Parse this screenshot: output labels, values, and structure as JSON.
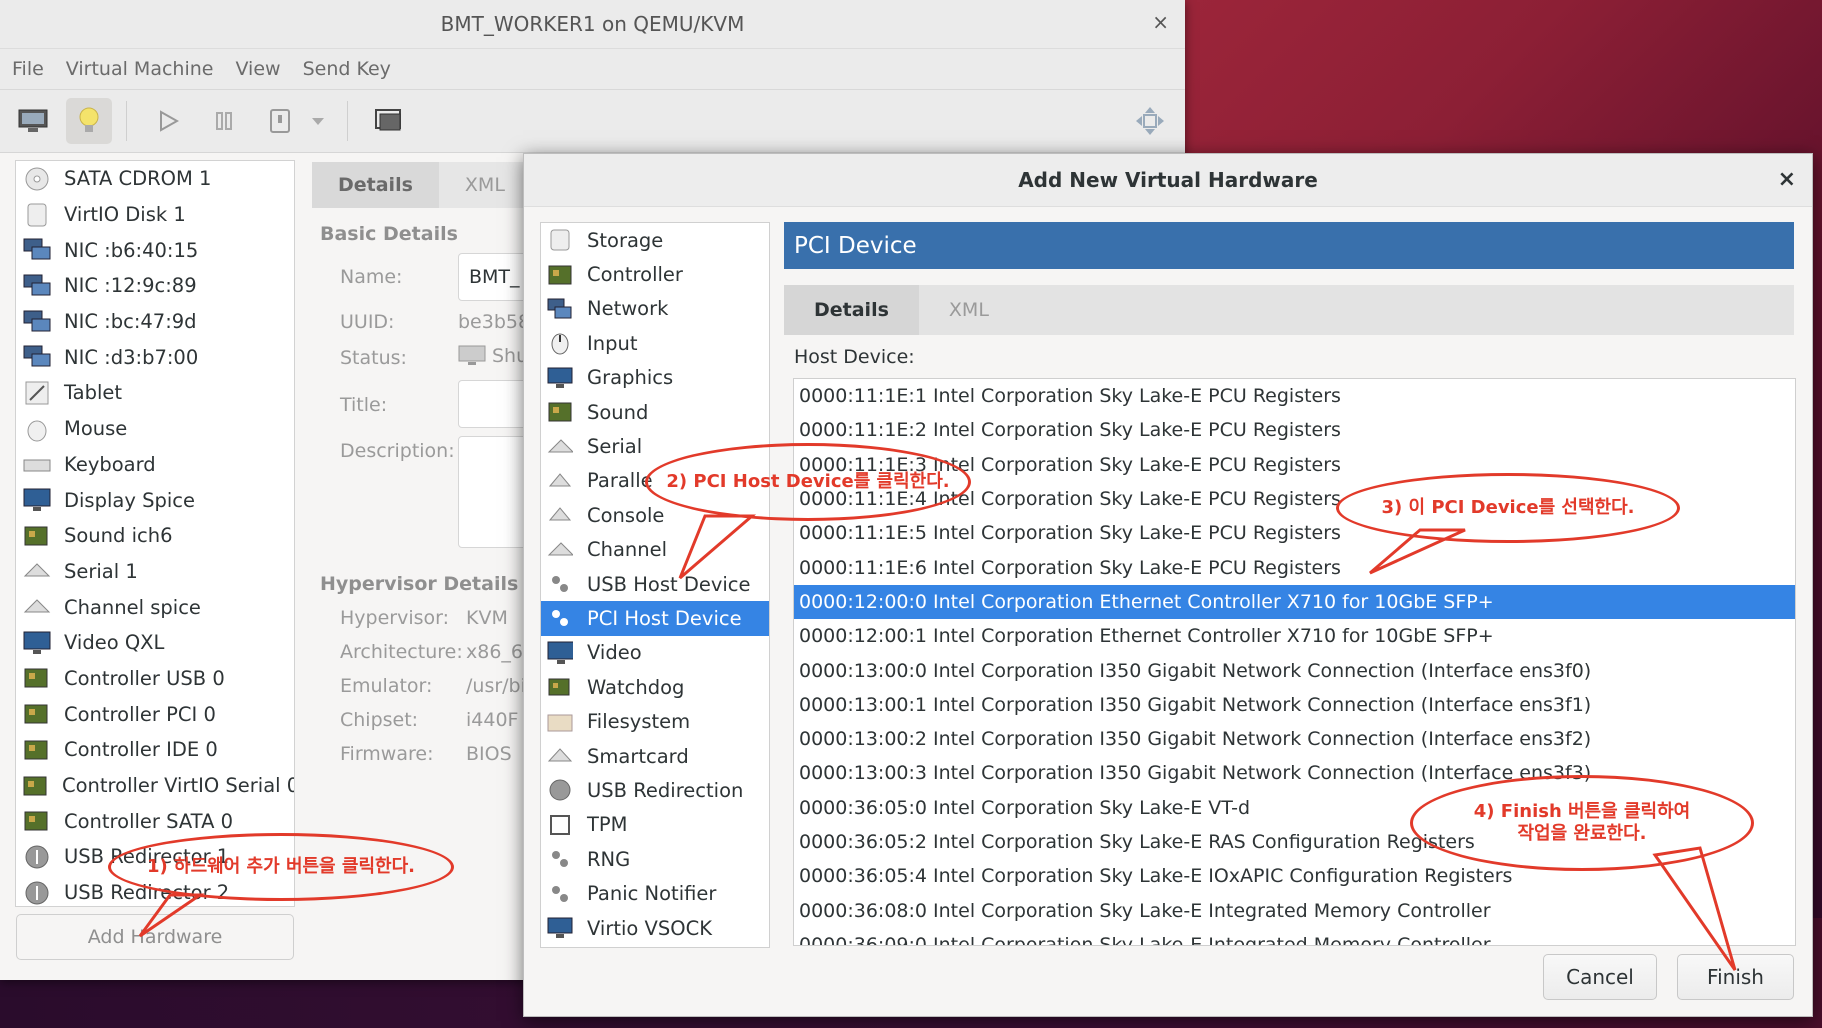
{
  "main_window": {
    "title": "BMT_WORKER1 on QEMU/KVM",
    "close_glyph": "×",
    "menu": [
      "File",
      "Virtual Machine",
      "View",
      "Send Key"
    ],
    "hardware_items": [
      {
        "label": "SATA CDROM 1",
        "icon": "cdrom-icon"
      },
      {
        "label": "VirtIO Disk 1",
        "icon": "disk-icon"
      },
      {
        "label": "NIC :b6:40:15",
        "icon": "nic-icon"
      },
      {
        "label": "NIC :12:9c:89",
        "icon": "nic-icon"
      },
      {
        "label": "NIC :bc:47:9d",
        "icon": "nic-icon"
      },
      {
        "label": "NIC :d3:b7:00",
        "icon": "nic-icon"
      },
      {
        "label": "Tablet",
        "icon": "tablet-icon"
      },
      {
        "label": "Mouse",
        "icon": "mouse-icon"
      },
      {
        "label": "Keyboard",
        "icon": "keyboard-icon"
      },
      {
        "label": "Display Spice",
        "icon": "display-icon"
      },
      {
        "label": "Sound ich6",
        "icon": "sound-icon"
      },
      {
        "label": "Serial 1",
        "icon": "serial-icon"
      },
      {
        "label": "Channel spice",
        "icon": "channel-icon"
      },
      {
        "label": "Video QXL",
        "icon": "video-icon"
      },
      {
        "label": "Controller USB 0",
        "icon": "controller-icon"
      },
      {
        "label": "Controller PCI 0",
        "icon": "controller-icon"
      },
      {
        "label": "Controller IDE 0",
        "icon": "controller-icon"
      },
      {
        "label": "Controller VirtIO Serial 0",
        "icon": "controller-icon"
      },
      {
        "label": "Controller SATA 0",
        "icon": "controller-icon"
      },
      {
        "label": "USB Redirector 1",
        "icon": "usb-icon"
      },
      {
        "label": "USB Redirector 2",
        "icon": "usb-icon"
      }
    ],
    "add_hardware_label": "Add Hardware",
    "tabs": [
      "Details",
      "XML"
    ],
    "basic_details": {
      "heading": "Basic Details",
      "name_label": "Name:",
      "name_value": "BMT_",
      "uuid_label": "UUID:",
      "uuid_value": "be3b58",
      "status_label": "Status:",
      "status_value": "Shu",
      "title_label": "Title:",
      "description_label": "Description:"
    },
    "hypervisor_details": {
      "heading": "Hypervisor Details",
      "hypervisor_label": "Hypervisor:",
      "hypervisor_value": "KVM",
      "architecture_label": "Architecture:",
      "architecture_value": "x86_6",
      "emulator_label": "Emulator:",
      "emulator_value": "/usr/bi",
      "chipset_label": "Chipset:",
      "chipset_value": "i440F",
      "firmware_label": "Firmware:",
      "firmware_value": "BIOS"
    }
  },
  "dialog": {
    "title": "Add New Virtual Hardware",
    "close_glyph": "×",
    "categories": [
      {
        "label": "Storage",
        "icon": "storage-icon"
      },
      {
        "label": "Controller",
        "icon": "controller-icon"
      },
      {
        "label": "Network",
        "icon": "network-icon"
      },
      {
        "label": "Input",
        "icon": "input-icon"
      },
      {
        "label": "Graphics",
        "icon": "graphics-icon"
      },
      {
        "label": "Sound",
        "icon": "sound-icon"
      },
      {
        "label": "Serial",
        "icon": "serial-icon"
      },
      {
        "label": "Paralle",
        "icon": "parallel-icon"
      },
      {
        "label": "Console",
        "icon": "console-icon"
      },
      {
        "label": "Channel",
        "icon": "channel-icon"
      },
      {
        "label": "USB Host Device",
        "icon": "usb-host-icon"
      },
      {
        "label": "PCI Host Device",
        "icon": "pci-host-icon"
      },
      {
        "label": "Video",
        "icon": "video-icon"
      },
      {
        "label": "Watchdog",
        "icon": "watchdog-icon"
      },
      {
        "label": "Filesystem",
        "icon": "filesystem-icon"
      },
      {
        "label": "Smartcard",
        "icon": "smartcard-icon"
      },
      {
        "label": "USB Redirection",
        "icon": "usb-redirection-icon"
      },
      {
        "label": "TPM",
        "icon": "tpm-icon"
      },
      {
        "label": "RNG",
        "icon": "rng-icon"
      },
      {
        "label": "Panic Notifier",
        "icon": "panic-icon"
      },
      {
        "label": "Virtio VSOCK",
        "icon": "vsock-icon"
      }
    ],
    "selected_category": "PCI Host Device",
    "banner": "PCI Device",
    "tabs": [
      "Details",
      "XML"
    ],
    "host_device_label": "Host Device:",
    "devices": [
      "0000:11:1E:1 Intel Corporation Sky Lake-E PCU Registers",
      "0000:11:1E:2 Intel Corporation Sky Lake-E PCU Registers",
      "0000:11:1E:3 Intel Corporation Sky Lake-E PCU Registers",
      "0000:11:1E:4 Intel Corporation Sky Lake-E PCU Registers",
      "0000:11:1E:5 Intel Corporation Sky Lake-E PCU Registers",
      "0000:11:1E:6 Intel Corporation Sky Lake-E PCU Registers",
      "0000:12:00:0 Intel Corporation Ethernet Controller X710 for 10GbE SFP+",
      "0000:12:00:1 Intel Corporation Ethernet Controller X710 for 10GbE SFP+",
      "0000:13:00:0 Intel Corporation I350 Gigabit Network Connection (Interface ens3f0)",
      "0000:13:00:1 Intel Corporation I350 Gigabit Network Connection (Interface ens3f1)",
      "0000:13:00:2 Intel Corporation I350 Gigabit Network Connection (Interface ens3f2)",
      "0000:13:00:3 Intel Corporation I350 Gigabit Network Connection (Interface ens3f3)",
      "0000:36:05:0 Intel Corporation Sky Lake-E VT-d",
      "0000:36:05:2 Intel Corporation Sky Lake-E RAS Configuration Registers",
      "0000:36:05:4 Intel Corporation Sky Lake-E IOxAPIC Configuration Registers",
      "0000:36:08:0 Intel Corporation Sky Lake-E Integrated Memory Controller",
      "0000:36:09:0 Intel Corporation Sky Lake-E Integrated Memory Controller"
    ],
    "selected_device": "0000:12:00:0 Intel Corporation Ethernet Controller X710 for 10GbE SFP+",
    "cancel_label": "Cancel",
    "finish_label": "Finish"
  },
  "annotations": {
    "step1": "1) 하드웨어 추가 버튼을 클릭한다.",
    "step2": "2) PCI Host Device를 클릭한다.",
    "step3": "3) 이 PCI Device를 선택한다.",
    "step4_line1": "4) Finish 버튼을 클릭하여",
    "step4_line2": "작업을 완료한다."
  },
  "colors": {
    "selection": "#3584e4",
    "banner": "#3970ac",
    "annotation": "#e23a2a"
  }
}
